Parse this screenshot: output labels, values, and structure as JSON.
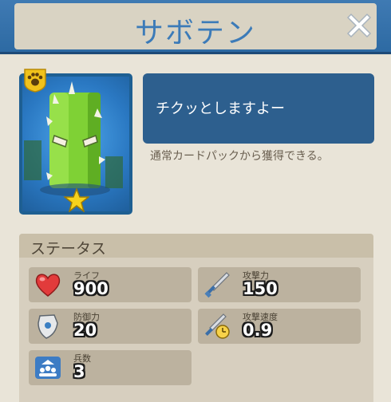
{
  "header": {
    "title": "サボテン",
    "close_icon": "close-x-icon"
  },
  "card": {
    "badge_icon": "paw-icon",
    "rarity_icon": "star-icon",
    "character": "cactus"
  },
  "description": {
    "quote": "チクッとしますよー",
    "acquire": "通常カードパックから獲得できる。"
  },
  "status": {
    "title": "ステータス",
    "stats": [
      {
        "label": "ライフ",
        "value": "900",
        "icon": "heart-icon"
      },
      {
        "label": "攻撃力",
        "value": "150",
        "icon": "sword-icon"
      },
      {
        "label": "防御力",
        "value": "20",
        "icon": "shield-icon"
      },
      {
        "label": "攻撃速度",
        "value": "0.9",
        "icon": "sword-speed-icon"
      },
      {
        "label": "兵数",
        "value": "3",
        "icon": "troops-icon"
      }
    ]
  },
  "colors": {
    "header": "#2d6aa3",
    "title_text": "#3c7bb8",
    "speech_box": "#2d5f8e",
    "card_frame": "#1e5f92"
  }
}
